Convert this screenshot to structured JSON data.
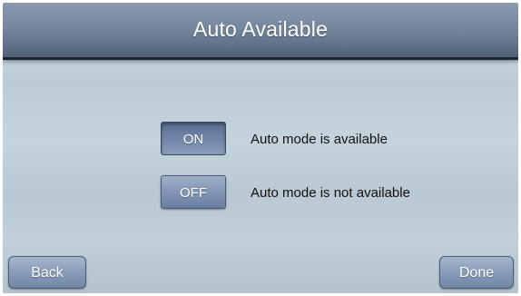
{
  "header": {
    "title": "Auto Available"
  },
  "options": [
    {
      "button_label": "ON",
      "description": "Auto mode is available",
      "selected": true
    },
    {
      "button_label": "OFF",
      "description": "Auto mode is not available",
      "selected": false
    }
  ],
  "footer": {
    "back_label": "Back",
    "done_label": "Done"
  },
  "colors": {
    "header_top": "#8b9aae",
    "header_bottom": "#4f5f75",
    "button_blue": "#7a8db0",
    "background": "#c5d3dc",
    "text_dark": "#111111"
  }
}
